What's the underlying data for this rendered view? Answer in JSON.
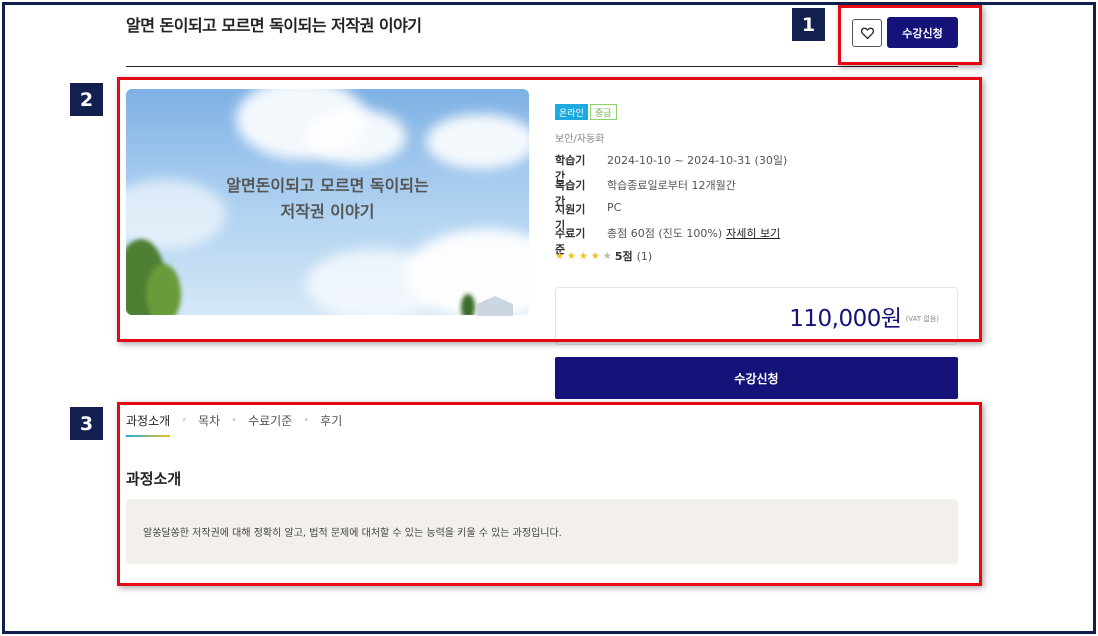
{
  "header": {
    "title": "알면 돈이되고 모르면 독이되는 저작권 이야기",
    "apply_label": "수강신청"
  },
  "annotations": [
    "1",
    "2",
    "3"
  ],
  "course": {
    "thumbnail_lines": [
      "알면돈이되고 모르면 독이되는",
      "저작권 이야기"
    ],
    "tags": {
      "online": "온라인",
      "level": "중급"
    },
    "category": "보안/자동화",
    "info": [
      {
        "label": "학습기간",
        "value": "2024-10-10 ~ 2024-10-31 (30일)"
      },
      {
        "label": "복습기간",
        "value": "학습종료일로부터 12개월간"
      },
      {
        "label": "지원기기",
        "value": "PC"
      },
      {
        "label": "수료기준",
        "value": "총점 60점 (진도 100%)",
        "link": "자세히 보기"
      }
    ],
    "rating": {
      "stars_filled": 4,
      "stars_total": 5,
      "score": "5점",
      "count": "(1)"
    },
    "price": "110,000원",
    "vat_note": "(VAT 없음)",
    "apply_label": "수강신청"
  },
  "tabs": [
    {
      "label": "과정소개",
      "active": true
    },
    {
      "label": "목차"
    },
    {
      "label": "수료기준"
    },
    {
      "label": "후기"
    }
  ],
  "intro": {
    "heading": "과정소개",
    "description": "알쏭달쏭한 저작권에 대해 정확히 알고, 법적 문제에 대처할 수 있는 능력을 키울 수 있는 과정입니다."
  },
  "colors": {
    "accent": "#15127a",
    "annotation_red": "#e50914",
    "annotation_badge": "#13204f",
    "tag_online": "#1ea8e0",
    "tag_level": "#6dbb45",
    "star": "#f2c21b"
  }
}
